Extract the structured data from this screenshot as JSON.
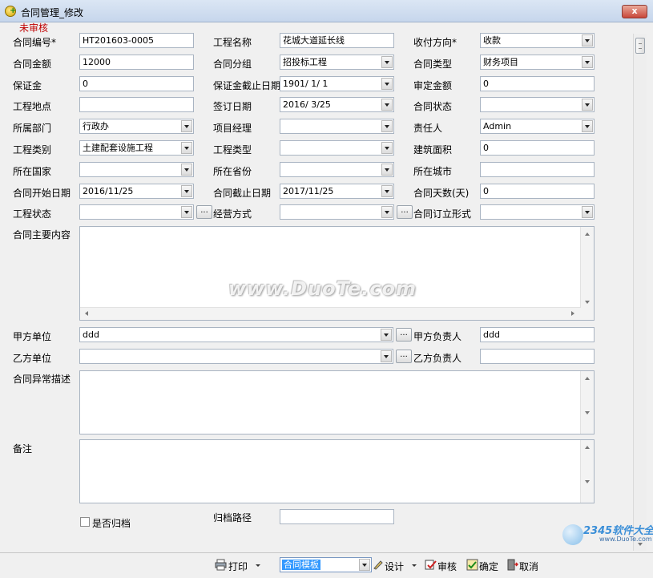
{
  "window": {
    "title": "合同管理_修改",
    "close": "x"
  },
  "status": "未审核",
  "rows": [
    [
      {
        "label": "合同编号*",
        "value": "HT201603-0005",
        "type": "text"
      },
      {
        "label": "工程名称",
        "value": "花城大道延长线",
        "type": "text"
      },
      {
        "label": "收付方向*",
        "value": "收款",
        "type": "combo"
      }
    ],
    [
      {
        "label": "合同金额",
        "value": "12000",
        "type": "text"
      },
      {
        "label": "合同分组",
        "value": "招投标工程",
        "type": "combo"
      },
      {
        "label": "合同类型",
        "value": "财务项目",
        "type": "combo"
      }
    ],
    [
      {
        "label": "保证金",
        "value": "0",
        "type": "text"
      },
      {
        "label": "保证金截止日期",
        "value": "1901/ 1/ 1",
        "type": "combo"
      },
      {
        "label": "审定金额",
        "value": "0",
        "type": "text"
      }
    ],
    [
      {
        "label": "工程地点",
        "value": "",
        "type": "text"
      },
      {
        "label": "签订日期",
        "value": "2016/ 3/25",
        "type": "combo"
      },
      {
        "label": "合同状态",
        "value": "",
        "type": "combo"
      }
    ],
    [
      {
        "label": "所属部门",
        "value": "行政办",
        "type": "combo"
      },
      {
        "label": "项目经理",
        "value": "",
        "type": "combo"
      },
      {
        "label": "责任人",
        "value": "Admin",
        "type": "combo"
      }
    ],
    [
      {
        "label": "工程类别",
        "value": "土建配套设施工程",
        "type": "combo"
      },
      {
        "label": "工程类型",
        "value": "",
        "type": "combo"
      },
      {
        "label": "建筑面积",
        "value": "0",
        "type": "text"
      }
    ],
    [
      {
        "label": "所在国家",
        "value": "",
        "type": "combo"
      },
      {
        "label": "所在省份",
        "value": "",
        "type": "combo"
      },
      {
        "label": "所在城市",
        "value": "",
        "type": "text"
      }
    ],
    [
      {
        "label": "合同开始日期",
        "value": "2016/11/25",
        "type": "combo"
      },
      {
        "label": "合同截止日期",
        "value": "2017/11/25",
        "type": "combo"
      },
      {
        "label": "合同天数(天)",
        "value": "0",
        "type": "text"
      }
    ],
    [
      {
        "label": "工程状态",
        "value": "",
        "type": "combo",
        "ellipsis": "..."
      },
      {
        "label": "经营方式",
        "value": "",
        "type": "combo",
        "ellipsis": "..."
      },
      {
        "label": "合同订立形式",
        "value": "",
        "type": "combo"
      }
    ]
  ],
  "memo_main": {
    "label": "合同主要内容"
  },
  "party_a": {
    "label": "甲方单位",
    "value": "ddd",
    "ellipsis": "...",
    "contact_label": "甲方负责人",
    "contact_value": "ddd"
  },
  "party_b": {
    "label": "乙方单位",
    "value": "",
    "ellipsis": "...",
    "contact_label": "乙方负责人",
    "contact_value": ""
  },
  "memo_exception": {
    "label": "合同异常描述"
  },
  "memo_remark": {
    "label": "备注"
  },
  "archive": {
    "checkbox_label": "是否归档",
    "path_label": "归档路径",
    "path_value": ""
  },
  "toolbar": {
    "print": "打印",
    "template": "合同模板",
    "design": "设计",
    "audit": "审核",
    "confirm": "确定",
    "cancel": "取消"
  },
  "watermark": "www.DuoTe.com",
  "corner_logo": {
    "brand": "2345软件大全",
    "url": "www.DuoTe.com"
  },
  "colors": {
    "status": "#c00000",
    "selection": "#3399ff",
    "watermark_logo": "#3b8fd8"
  }
}
